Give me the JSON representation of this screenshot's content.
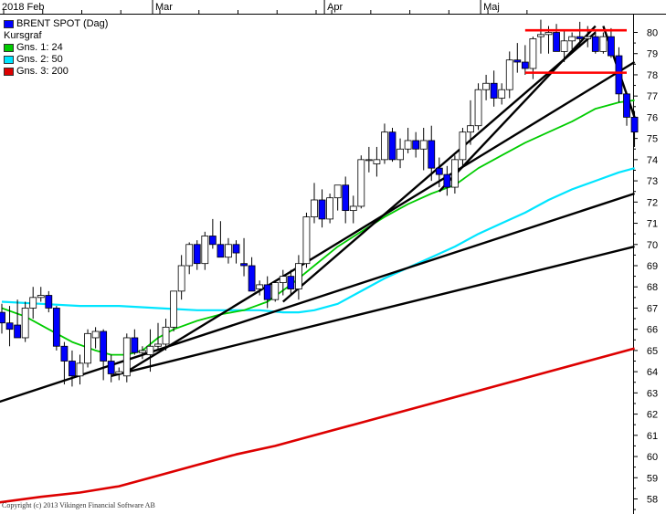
{
  "colors": {
    "background": "#ffffff",
    "up_candle": "#ffffff",
    "down_candle": "#0000ff",
    "candle_outline": "#000000",
    "ma24": "#00cc00",
    "ma50": "#00e5ff",
    "ma200": "#dd0000",
    "trendline": "#000000",
    "resistance": "#ff0000",
    "grid": "#000000"
  },
  "chart_data": {
    "type": "candlestick",
    "title": "BRENT SPOT (Dag)",
    "subtitle": "Kursgraf",
    "legend": [
      {
        "label": "BRENT SPOT (Dag)",
        "color": "#0000ff"
      },
      {
        "label": "Kursgraf",
        "color": ""
      },
      {
        "label": "Gns. 1: 24",
        "color": "#00cc00"
      },
      {
        "label": "Gns. 2: 50",
        "color": "#00e5ff"
      },
      {
        "label": "Gns. 3: 200",
        "color": "#dd0000"
      }
    ],
    "legend_position": "top-left",
    "y_ticks": [
      58,
      59,
      60,
      61,
      62,
      63,
      64,
      65,
      66,
      67,
      68,
      69,
      70,
      71,
      72,
      73,
      74,
      75,
      76,
      77,
      78,
      79,
      80
    ],
    "ylim": [
      57.5,
      80.5
    ],
    "y_axis_position": "right",
    "x_month_labels": [
      {
        "label": "2018 Feb",
        "index": 0
      },
      {
        "label": "Mar",
        "index": 20
      },
      {
        "label": "Apr",
        "index": 42
      },
      {
        "label": "Maj",
        "index": 62
      }
    ],
    "x_tick_indices": [
      0,
      5,
      10,
      15,
      20,
      25,
      30,
      35,
      40,
      42,
      47,
      52,
      57,
      62,
      67
    ],
    "x_count": 71,
    "candles": [
      [
        0,
        66.8,
        67.2,
        65.8,
        66.3
      ],
      [
        1,
        66.3,
        67.1,
        65.2,
        66.0
      ],
      [
        2,
        66.2,
        67.4,
        65.6,
        65.6
      ],
      [
        3,
        65.6,
        67.3,
        65.4,
        67.0
      ],
      [
        4,
        67.0,
        68.0,
        66.5,
        67.5
      ],
      [
        5,
        67.5,
        68.0,
        67.3,
        67.6
      ],
      [
        6,
        67.6,
        67.8,
        66.8,
        67.0
      ],
      [
        7,
        67.0,
        67.1,
        65.0,
        65.2
      ],
      [
        8,
        65.2,
        65.4,
        63.4,
        64.5
      ],
      [
        9,
        64.5,
        65.0,
        63.3,
        63.8
      ],
      [
        10,
        63.8,
        64.8,
        63.4,
        64.4
      ],
      [
        11,
        64.4,
        66.0,
        64.2,
        65.8
      ],
      [
        12,
        65.6,
        66.1,
        65.1,
        65.9
      ],
      [
        13,
        65.9,
        66.0,
        63.6,
        64.5
      ],
      [
        14,
        64.5,
        64.8,
        63.5,
        63.9
      ],
      [
        15,
        63.9,
        64.2,
        63.6,
        64.0
      ],
      [
        16,
        63.8,
        65.8,
        63.5,
        65.6
      ],
      [
        17,
        65.6,
        66.0,
        64.8,
        64.9
      ],
      [
        18,
        64.9,
        65.2,
        64.6,
        65.0
      ],
      [
        19,
        64.8,
        66.0,
        64.0,
        65.2
      ],
      [
        20,
        65.2,
        66.3,
        65.0,
        65.3
      ],
      [
        21,
        65.3,
        66.5,
        65.0,
        66.1
      ],
      [
        22,
        66.1,
        67.8,
        65.9,
        67.8
      ],
      [
        23,
        67.8,
        69.5,
        67.4,
        69.0
      ],
      [
        24,
        69.0,
        70.1,
        68.6,
        70.0
      ],
      [
        25,
        70.0,
        70.2,
        68.8,
        69.1
      ],
      [
        26,
        69.1,
        70.6,
        68.8,
        70.4
      ],
      [
        27,
        70.4,
        71.2,
        69.8,
        70.0
      ],
      [
        28,
        70.0,
        71.1,
        69.5,
        69.4
      ],
      [
        29,
        69.4,
        70.3,
        69.1,
        70.0
      ],
      [
        30,
        70.0,
        70.2,
        69.1,
        69.6
      ],
      [
        31,
        69.1,
        70.3,
        68.5,
        69.0
      ],
      [
        32,
        69.0,
        69.4,
        67.8,
        67.8
      ],
      [
        33,
        67.9,
        68.3,
        67.6,
        68.1
      ],
      [
        34,
        68.1,
        68.5,
        67.0,
        67.4
      ],
      [
        35,
        67.4,
        68.3,
        67.3,
        68.2
      ],
      [
        36,
        68.2,
        68.8,
        67.6,
        68.5
      ],
      [
        37,
        68.5,
        68.8,
        67.6,
        67.9
      ],
      [
        38,
        67.9,
        69.5,
        67.4,
        69.1
      ],
      [
        39,
        69.1,
        71.5,
        68.9,
        71.3
      ],
      [
        40,
        71.3,
        72.9,
        71.0,
        72.1
      ],
      [
        41,
        72.1,
        72.6,
        70.8,
        71.2
      ],
      [
        42,
        71.2,
        72.4,
        71.0,
        72.2
      ],
      [
        43,
        72.2,
        72.7,
        71.6,
        72.8
      ],
      [
        44,
        72.8,
        73.2,
        71.0,
        71.6
      ],
      [
        45,
        71.6,
        72.3,
        71.0,
        71.8
      ],
      [
        46,
        71.8,
        74.2,
        71.7,
        74.0
      ],
      [
        47,
        74.0,
        74.6,
        73.4,
        74.0
      ],
      [
        48,
        73.8,
        74.6,
        73.2,
        74.0
      ],
      [
        49,
        74.0,
        75.7,
        73.8,
        75.3
      ],
      [
        50,
        75.3,
        75.5,
        73.9,
        74.0
      ],
      [
        51,
        74.0,
        75.0,
        73.6,
        74.5
      ],
      [
        52,
        74.5,
        75.5,
        74.3,
        74.9
      ],
      [
        53,
        74.9,
        75.3,
        74.1,
        74.5
      ],
      [
        54,
        74.5,
        75.5,
        73.5,
        74.9
      ],
      [
        55,
        74.9,
        75.6,
        73.0,
        73.6
      ],
      [
        56,
        73.6,
        74.1,
        72.7,
        73.3
      ],
      [
        57,
        73.3,
        73.7,
        72.3,
        72.7
      ],
      [
        58,
        72.7,
        74.2,
        72.4,
        74.0
      ],
      [
        59,
        74.0,
        75.5,
        73.6,
        75.3
      ],
      [
        60,
        75.3,
        76.8,
        74.7,
        75.6
      ],
      [
        61,
        75.6,
        77.6,
        75.4,
        77.3
      ],
      [
        62,
        77.3,
        78.0,
        76.8,
        77.6
      ],
      [
        63,
        77.6,
        78.2,
        76.5,
        76.9
      ],
      [
        64,
        76.9,
        77.6,
        76.6,
        77.3
      ],
      [
        65,
        77.3,
        79.1,
        76.9,
        78.7
      ],
      [
        66,
        78.7,
        79.5,
        78.1,
        78.6
      ],
      [
        67,
        78.6,
        79.4,
        78.0,
        78.3
      ],
      [
        68,
        78.3,
        79.8,
        77.8,
        79.7
      ],
      [
        69,
        79.8,
        80.6,
        79.0,
        79.9
      ],
      [
        70,
        79.9,
        80.3,
        79.0,
        80.0
      ],
      [
        71,
        80.0,
        80.4,
        79.5,
        79.1
      ],
      [
        72,
        79.1,
        80.1,
        78.6,
        79.6
      ],
      [
        73,
        79.6,
        80.0,
        79.2,
        79.8
      ],
      [
        74,
        79.8,
        80.5,
        79.3,
        79.7
      ],
      [
        75,
        79.7,
        80.3,
        79.3,
        79.8
      ],
      [
        76,
        79.8,
        80.1,
        79.0,
        79.1
      ],
      [
        77,
        79.1,
        80.0,
        79.0,
        79.8
      ],
      [
        78,
        79.8,
        80.2,
        78.8,
        78.9
      ],
      [
        79,
        78.9,
        79.3,
        76.7,
        77.1
      ],
      [
        80,
        77.1,
        77.2,
        75.6,
        76.0
      ],
      [
        81,
        76.0,
        76.3,
        74.6,
        75.3
      ]
    ],
    "ma_series": [
      {
        "name": "Gns. 1: 24",
        "color": "#00cc00",
        "points": [
          [
            0,
            67.0
          ],
          [
            3,
            66.6
          ],
          [
            6,
            66.0
          ],
          [
            9,
            65.4
          ],
          [
            12,
            65.0
          ],
          [
            14,
            64.8
          ],
          [
            16,
            64.8
          ],
          [
            18,
            65.0
          ],
          [
            20,
            65.6
          ],
          [
            22,
            66.0
          ],
          [
            25,
            66.4
          ],
          [
            28,
            66.7
          ],
          [
            31,
            66.9
          ],
          [
            34,
            67.3
          ],
          [
            37,
            68.1
          ],
          [
            40,
            69.0
          ],
          [
            43,
            69.9
          ],
          [
            46,
            70.6
          ],
          [
            49,
            71.3
          ],
          [
            52,
            71.9
          ],
          [
            55,
            72.4
          ],
          [
            58,
            72.8
          ],
          [
            61,
            73.6
          ],
          [
            64,
            74.2
          ],
          [
            67,
            74.8
          ],
          [
            70,
            75.3
          ],
          [
            73,
            75.8
          ],
          [
            76,
            76.4
          ],
          [
            79,
            76.7
          ],
          [
            81,
            76.8
          ]
        ]
      },
      {
        "name": "Gns. 2: 50",
        "color": "#00e5ff",
        "points": [
          [
            0,
            67.3
          ],
          [
            5,
            67.2
          ],
          [
            10,
            67.1
          ],
          [
            15,
            67.1
          ],
          [
            20,
            67.0
          ],
          [
            25,
            66.9
          ],
          [
            30,
            66.9
          ],
          [
            33,
            66.9
          ],
          [
            36,
            66.8
          ],
          [
            38,
            66.8
          ],
          [
            40,
            66.9
          ],
          [
            43,
            67.2
          ],
          [
            46,
            67.8
          ],
          [
            49,
            68.4
          ],
          [
            52,
            68.9
          ],
          [
            55,
            69.4
          ],
          [
            58,
            69.9
          ],
          [
            61,
            70.5
          ],
          [
            64,
            71.0
          ],
          [
            67,
            71.5
          ],
          [
            70,
            72.1
          ],
          [
            73,
            72.6
          ],
          [
            76,
            73.0
          ],
          [
            79,
            73.4
          ],
          [
            81,
            73.6
          ]
        ]
      },
      {
        "name": "Gns. 3: 200",
        "color": "#dd0000",
        "points": [
          [
            -1,
            57.8
          ],
          [
            5,
            58.1
          ],
          [
            10,
            58.3
          ],
          [
            15,
            58.6
          ],
          [
            20,
            59.1
          ],
          [
            25,
            59.6
          ],
          [
            30,
            60.1
          ],
          [
            35,
            60.5
          ],
          [
            40,
            61.0
          ],
          [
            45,
            61.5
          ],
          [
            50,
            62.0
          ],
          [
            55,
            62.5
          ],
          [
            60,
            63.0
          ],
          [
            65,
            63.5
          ],
          [
            70,
            64.0
          ],
          [
            75,
            64.5
          ],
          [
            79,
            64.9
          ],
          [
            81,
            65.1
          ]
        ]
      }
    ],
    "trendlines": [
      [
        [
          -1,
          62.5
        ],
        [
          81,
          72.4
        ]
      ],
      [
        [
          14,
          63.8
        ],
        [
          81,
          69.9
        ]
      ],
      [
        [
          16,
          64.0
        ],
        [
          81,
          78.6
        ]
      ],
      [
        [
          36,
          67.3
        ],
        [
          76,
          80.0
        ]
      ],
      [
        [
          56,
          72.5
        ],
        [
          76,
          80.3
        ]
      ],
      [
        [
          77,
          80.3
        ],
        [
          81,
          76.0
        ]
      ]
    ],
    "resistance_lines": [
      {
        "y": 80.1,
        "x0": 67,
        "x1": 80
      },
      {
        "y": 78.1,
        "x0": 67,
        "x1": 80
      }
    ],
    "copyright": "Copyright (c) 2013 Vikingen Financial Software AB"
  }
}
